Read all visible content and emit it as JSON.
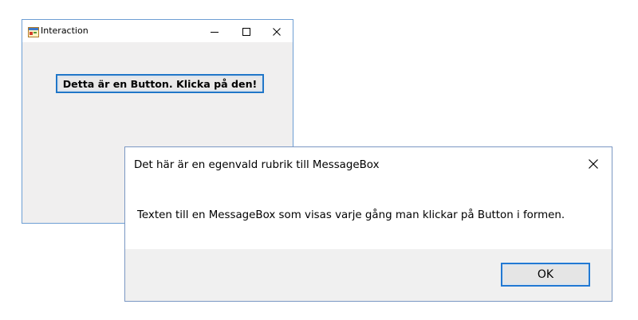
{
  "form_window": {
    "title": "Interaction",
    "icon": "app-form-icon",
    "caption_buttons": {
      "minimize_icon": "minimize-icon",
      "maximize_icon": "maximize-icon",
      "close_icon": "close-icon"
    },
    "button_label": "Detta är en Button. Klicka på den!"
  },
  "message_box": {
    "title": "Det här är en egenvald rubrik till MessageBox",
    "text": "Texten till en MessageBox som visas varje gång man klickar på Button i formen.",
    "close_icon": "close-icon",
    "ok_label": "OK"
  },
  "colors": {
    "window_border": "#6d9ed3",
    "client_background": "#f0efef",
    "button_focus_border": "#1f76c9",
    "dialog_border": "#7a97c3",
    "dialog_footer": "#f0f0f0"
  }
}
